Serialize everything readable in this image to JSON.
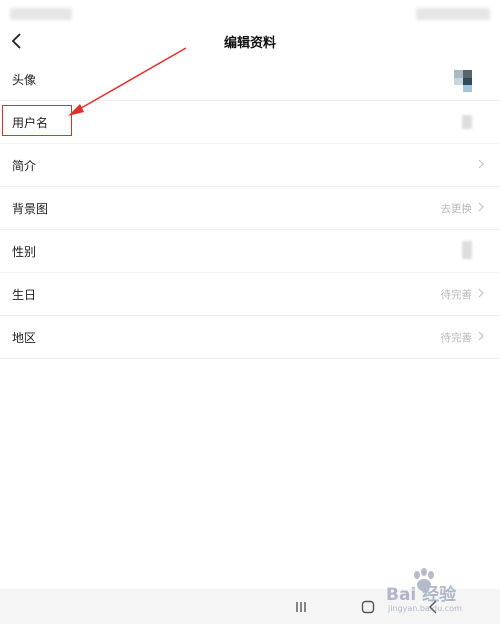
{
  "header": {
    "title": "编辑资料"
  },
  "rows": [
    {
      "label": "头像",
      "value": ""
    },
    {
      "label": "用户名",
      "value": ""
    },
    {
      "label": "简介",
      "value": ""
    },
    {
      "label": "背景图",
      "value": "去更换"
    },
    {
      "label": "性别",
      "value": ""
    },
    {
      "label": "生日",
      "value": "待完善"
    },
    {
      "label": "地区",
      "value": "待完善"
    }
  ],
  "icons": {
    "back": "chevron-left-icon",
    "row_arrow": "chevron-right-icon",
    "nav_recents": "recents-icon",
    "nav_home": "home-icon",
    "nav_back": "back-icon"
  },
  "colors": {
    "annotation": "#e0302a",
    "secondary_text": "#b8b8b8",
    "nav_bar": "#f5f5f5"
  },
  "watermark": {
    "brand": "Bai 经验",
    "url": "jingyan.baidu.com"
  }
}
